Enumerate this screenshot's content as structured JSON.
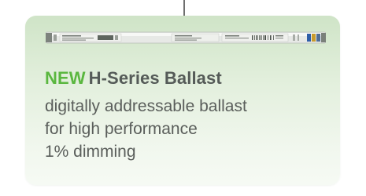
{
  "product_card": {
    "badge": "NEW",
    "title": "H-Series Ballast",
    "description_lines": [
      "digitally addressable ballast",
      "for high performance",
      "1% dimming"
    ],
    "colors": {
      "badge": "#5ab73f",
      "title": "#555b58",
      "body_text": "#5a5e5b",
      "card_top": "#cfe4c7",
      "card_bottom": "#f6faf4",
      "connector": "#6f6f6f"
    }
  }
}
